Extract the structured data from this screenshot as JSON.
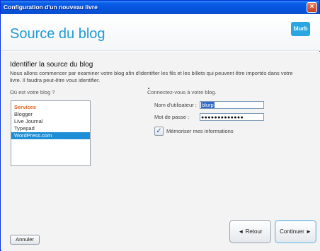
{
  "window": {
    "title": "Configuration d'un nouveau livre",
    "close_glyph": "×"
  },
  "header": {
    "title": "Source du blog",
    "logo_text": "blurb",
    "accent_color": "#1f9bd6"
  },
  "main": {
    "section_title": "Identifier la source du blog",
    "intro": "Nous allons commencer par examiner votre blog afin d'identifier les fils et les billets qui peuvent être importés dans votre livre. Il faudra peut-être vous identifier.",
    "left_label": "Où est votre blog ?",
    "sources": {
      "group_label": "Services",
      "items": [
        "Blogger",
        "Live Journal",
        "Typepad",
        "WordPress.com"
      ],
      "selected": "WordPress.com"
    },
    "login": {
      "label": "Connectez-vous à votre blog.",
      "username_label": "Nom d'utilisateur :",
      "username_value": "blurp",
      "password_label": "Mot de passe :",
      "password_mask": "●●●●●●●●●●●●●",
      "remember_label": "Mémoriser mes informations",
      "remember_checked": true
    }
  },
  "footer": {
    "back_label": "◄ Retour",
    "next_label": "Continuer ►",
    "cancel_label": "Annuler"
  }
}
